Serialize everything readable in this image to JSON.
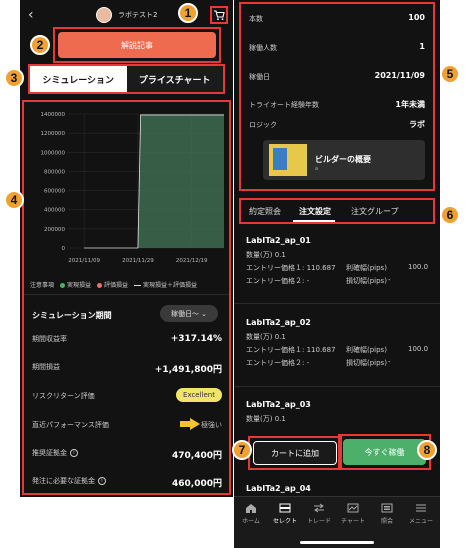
{
  "left": {
    "username": "ラボテスト2",
    "kaisetsu_button": "解説記事",
    "tabs": [
      "シミュレーション",
      "プライスチャート"
    ],
    "chart_data": {
      "type": "area",
      "y_ticks": [
        "1400000",
        "1200000",
        "1000000",
        "800000",
        "600000",
        "400000",
        "200000",
        "0"
      ],
      "x_ticks": [
        "2021/11/09",
        "2021/11/29",
        "2021/12/19"
      ],
      "ylim": [
        0,
        1400000
      ],
      "series": [
        {
          "name": "実現損益",
          "x": [
            "2021/11/09",
            "2021/11/29",
            "2021/11/30",
            "2021/12/31"
          ],
          "values": [
            0,
            0,
            1390000,
            1390000
          ],
          "color": "#4caf6a"
        }
      ]
    },
    "legend": {
      "note": "注意事項",
      "items": [
        {
          "label": "実現損益",
          "color": "#4caf6a",
          "kind": "dot"
        },
        {
          "label": "評価損益",
          "color": "#e57373",
          "kind": "dot"
        },
        {
          "label": "実現損益＋評価損益",
          "color": "#dddddd",
          "kind": "line"
        }
      ]
    },
    "sim": {
      "title": "シミュレーション期間",
      "period_button": "稼働日〜 ⌄",
      "rows": [
        {
          "label": "期間収益率",
          "value": "+317.14%"
        },
        {
          "label": "期間損益",
          "value": "+1,491,800円"
        },
        {
          "label": "リスクリターン評価",
          "value": "Excellent"
        },
        {
          "label": "直近パフォーマンス評価",
          "value": "極強い"
        },
        {
          "label": "推奨証拠金",
          "value": "470,400円"
        },
        {
          "label": "発注に必要な証拠金",
          "value": "460,000円"
        }
      ]
    }
  },
  "right": {
    "info": [
      {
        "label": "本数",
        "value": "100"
      },
      {
        "label": "稼働人数",
        "value": "1"
      },
      {
        "label": "稼働日",
        "value": "2021/11/09"
      },
      {
        "label": "トライオート経験年数",
        "value": "1年未満"
      },
      {
        "label": "ロジック",
        "value": "ラボ"
      }
    ],
    "book": {
      "title": "ビルダーの概要",
      "sub": "a"
    },
    "tabs": [
      "約定照会",
      "注文設定",
      "注文グループ"
    ],
    "orders": [
      {
        "name": "LabITa2_ap_01",
        "qty_label": "数量(万)",
        "qty": "0.1",
        "entry1": "エントリー価格１: 110.687",
        "profit_label": "利確幅(pips)",
        "profit": "100.0",
        "entry2": "エントリー価格２: -",
        "loss_label": "損切幅(pips)",
        "loss": "-"
      },
      {
        "name": "LabITa2_ap_02",
        "qty_label": "数量(万)",
        "qty": "0.1",
        "entry1": "エントリー価格１: 110.687",
        "profit_label": "利確幅(pips)",
        "profit": "100.0",
        "entry2": "エントリー価格２: -",
        "loss_label": "損切幅(pips)",
        "loss": "-"
      },
      {
        "name": "LabITa2_ap_03",
        "qty_label": "数量(万)",
        "qty": "0.1"
      }
    ],
    "peek": "LabITa2_ap_04",
    "buttons": {
      "cart": "カートに追加",
      "run": "今すぐ稼働"
    },
    "nav": [
      "ホーム",
      "セレクト",
      "トレード",
      "チャート",
      "照会",
      "メニュー"
    ]
  },
  "markers": [
    "1",
    "2",
    "3",
    "4",
    "5",
    "6",
    "7",
    "8"
  ]
}
